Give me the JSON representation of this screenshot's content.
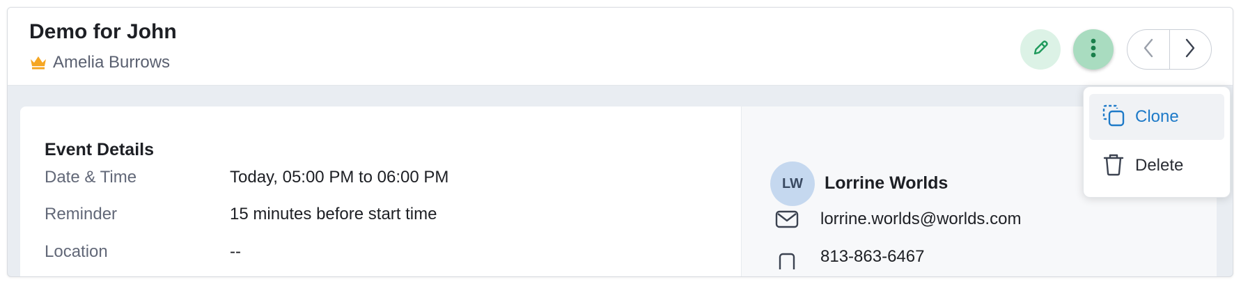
{
  "header": {
    "title": "Demo for John",
    "owner_name": "Amelia Burrows"
  },
  "toolbar": {
    "edit_icon": "pencil-icon",
    "more_icon": "vertical-dots-icon",
    "prev_icon": "chevron-left-icon",
    "next_icon": "chevron-right-icon"
  },
  "more_menu": {
    "items": [
      {
        "label": "Clone",
        "icon": "clone-icon"
      },
      {
        "label": "Delete",
        "icon": "trash-icon"
      }
    ]
  },
  "event_details": {
    "title": "Event Details",
    "rows": [
      {
        "label": "Date & Time",
        "value": "Today, 05:00 PM to 06:00 PM"
      },
      {
        "label": "Reminder",
        "value": "15 minutes before start time"
      },
      {
        "label": "Location",
        "value": "--"
      }
    ]
  },
  "contact": {
    "initials": "LW",
    "name": "Lorrine Worlds",
    "email": "lorrine.worlds@worlds.com",
    "phone": "813-863-6467"
  },
  "colors": {
    "accent_green": "#1f9a5c",
    "accent_blue": "#1e7ac8",
    "crown": "#f5a623"
  }
}
